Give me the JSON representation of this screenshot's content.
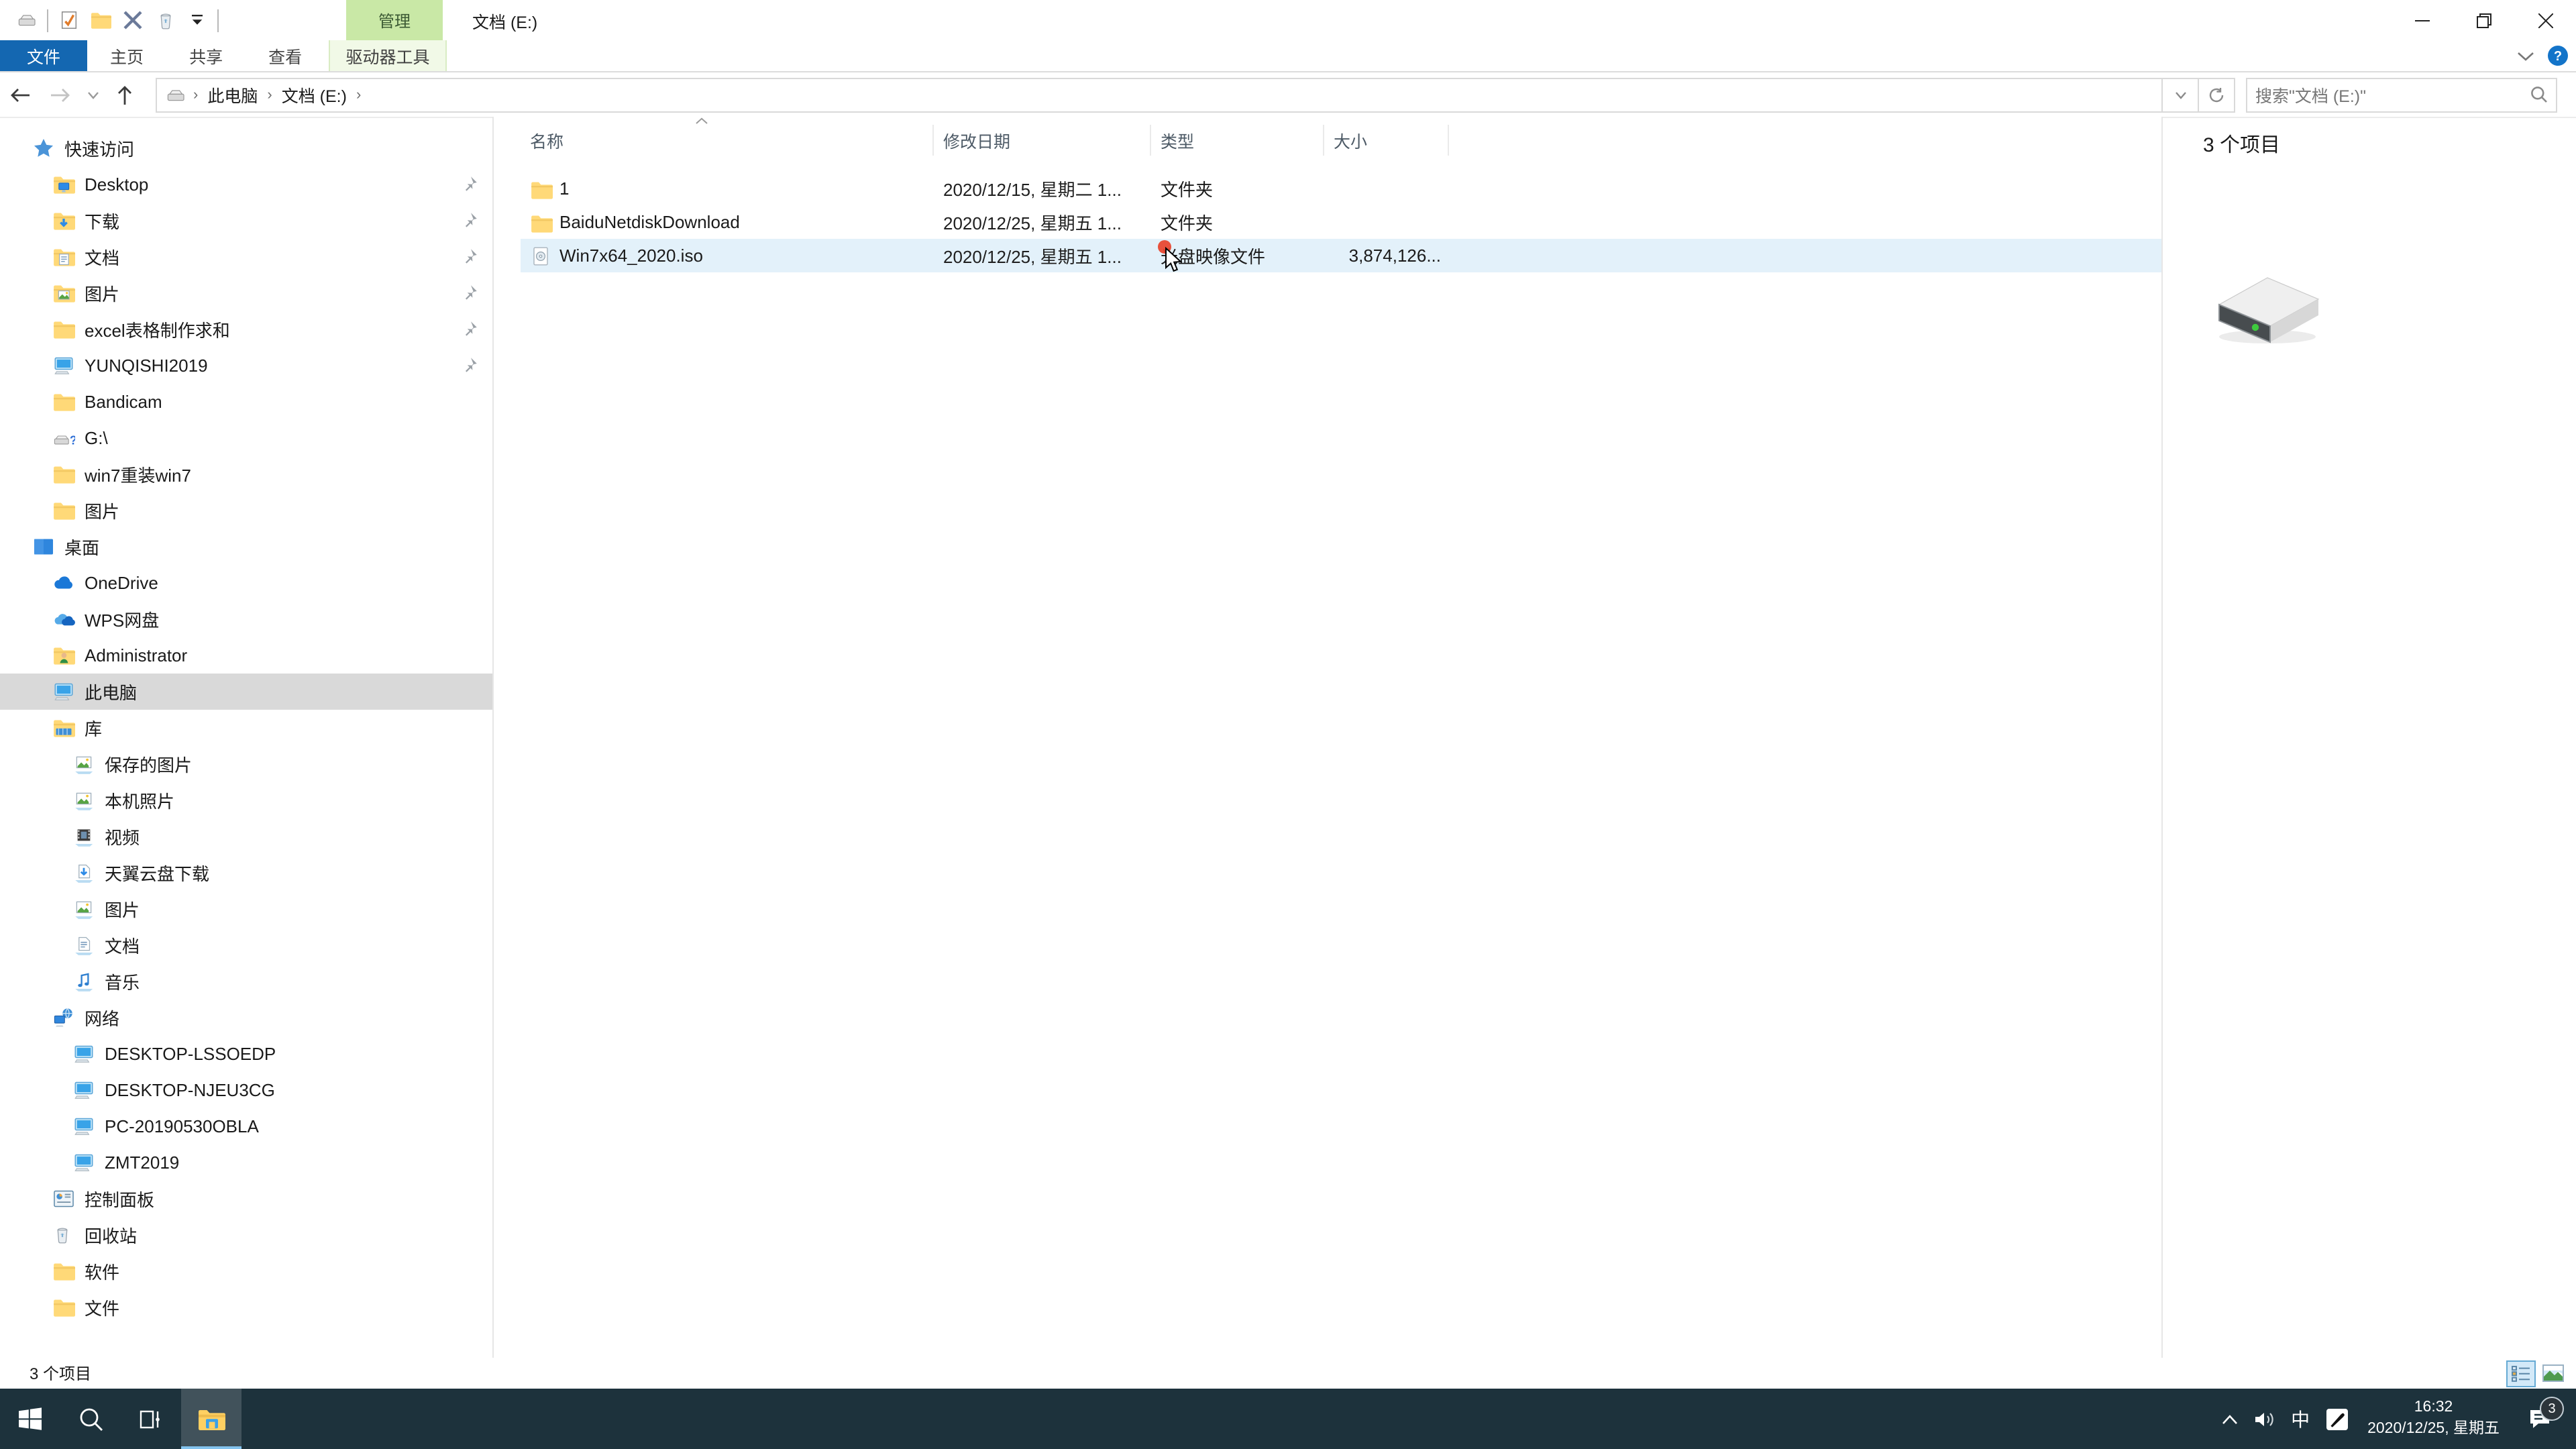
{
  "window": {
    "title": "文档 (E:)",
    "contextual_group": "管理"
  },
  "qat": {
    "buttons": [
      "drive-icon",
      "separator",
      "properties-icon",
      "new-folder-icon",
      "delete-icon",
      "recycle-bin-icon",
      "qat-dropdown-icon",
      "separator"
    ]
  },
  "ribbon": {
    "file_tab": "文件",
    "tabs": [
      "主页",
      "共享",
      "查看"
    ],
    "contextual_tab": "驱动器工具",
    "right_icons": [
      "ribbon-collapse-chevron-icon",
      "help-icon"
    ]
  },
  "address": {
    "crumbs": [
      "此电脑",
      "文档 (E:)"
    ],
    "search_placeholder": "搜索\"文档 (E:)\""
  },
  "sidebar": {
    "items": [
      {
        "label": "快速访问",
        "icon": "quick-access-star-icon",
        "indent": 0
      },
      {
        "label": "Desktop",
        "icon": "folder-desktop-icon",
        "indent": 1,
        "pinned": true
      },
      {
        "label": "下载",
        "icon": "folder-download-icon",
        "indent": 1,
        "pinned": true
      },
      {
        "label": "文档",
        "icon": "folder-documents-icon",
        "indent": 1,
        "pinned": true
      },
      {
        "label": "图片",
        "icon": "folder-pictures-icon",
        "indent": 1,
        "pinned": true
      },
      {
        "label": "excel表格制作求和",
        "icon": "folder-icon",
        "indent": 1,
        "pinned": true
      },
      {
        "label": "YUNQISHI2019",
        "icon": "computer-icon",
        "indent": 1,
        "pinned": true
      },
      {
        "label": "Bandicam",
        "icon": "folder-icon",
        "indent": 1
      },
      {
        "label": "G:\\",
        "icon": "usb-drive-icon",
        "indent": 1
      },
      {
        "label": "win7重装win7",
        "icon": "folder-icon",
        "indent": 1
      },
      {
        "label": "图片",
        "icon": "folder-icon",
        "indent": 1
      },
      {
        "label": "桌面",
        "icon": "desktop-icon",
        "indent": 0
      },
      {
        "label": "OneDrive",
        "icon": "onedrive-cloud-icon",
        "indent": 1
      },
      {
        "label": "WPS网盘",
        "icon": "wps-cloud-icon",
        "indent": 1
      },
      {
        "label": "Administrator",
        "icon": "user-folder-icon",
        "indent": 1
      },
      {
        "label": "此电脑",
        "icon": "computer-icon",
        "indent": 1,
        "selected": true
      },
      {
        "label": "库",
        "icon": "library-icon",
        "indent": 1
      },
      {
        "label": "保存的图片",
        "icon": "library-pictures-icon",
        "indent": 2
      },
      {
        "label": "本机照片",
        "icon": "library-pictures-icon",
        "indent": 2
      },
      {
        "label": "视频",
        "icon": "library-videos-icon",
        "indent": 2
      },
      {
        "label": "天翼云盘下载",
        "icon": "library-download-icon",
        "indent": 2
      },
      {
        "label": "图片",
        "icon": "library-pictures-icon",
        "indent": 2
      },
      {
        "label": "文档",
        "icon": "library-documents-icon",
        "indent": 2
      },
      {
        "label": "音乐",
        "icon": "library-music-icon",
        "indent": 2
      },
      {
        "label": "网络",
        "icon": "network-icon",
        "indent": 1
      },
      {
        "label": "DESKTOP-LSSOEDP",
        "icon": "computer-icon",
        "indent": 2
      },
      {
        "label": "DESKTOP-NJEU3CG",
        "icon": "computer-icon",
        "indent": 2
      },
      {
        "label": "PC-20190530OBLA",
        "icon": "computer-icon",
        "indent": 2
      },
      {
        "label": "ZMT2019",
        "icon": "computer-icon",
        "indent": 2
      },
      {
        "label": "控制面板",
        "icon": "control-panel-icon",
        "indent": 1
      },
      {
        "label": "回收站",
        "icon": "recycle-bin-icon",
        "indent": 1
      },
      {
        "label": "软件",
        "icon": "folder-icon",
        "indent": 1
      },
      {
        "label": "文件",
        "icon": "folder-icon",
        "indent": 1
      }
    ]
  },
  "files": {
    "columns": [
      "名称",
      "修改日期",
      "类型",
      "大小"
    ],
    "rows": [
      {
        "icon": "folder-icon",
        "name": "1",
        "modified": "2020/12/15, 星期二 1...",
        "type": "文件夹",
        "size": ""
      },
      {
        "icon": "folder-icon",
        "name": "BaiduNetdiskDownload",
        "modified": "2020/12/25, 星期五 1...",
        "type": "文件夹",
        "size": ""
      },
      {
        "icon": "iso-file-icon",
        "name": "Win7x64_2020.iso",
        "modified": "2020/12/25, 星期五 1...",
        "type": "光盘映像文件",
        "size": "3,874,126...",
        "hover": true
      }
    ]
  },
  "preview": {
    "item_count": "3 个项目",
    "icon": "hard-drive-icon"
  },
  "status": {
    "item_count": "3 个项目"
  },
  "taskbar": {
    "ime_label": "中",
    "time": "16:32",
    "date": "2020/12/25, 星期五",
    "notification_count": "3",
    "icons": [
      "start-icon",
      "search-icon",
      "task-view-icon",
      "file-explorer-icon",
      "hidden-icons-chevron-icon",
      "speaker-icon",
      "pen-tray-icon",
      "action-center-icon"
    ]
  }
}
